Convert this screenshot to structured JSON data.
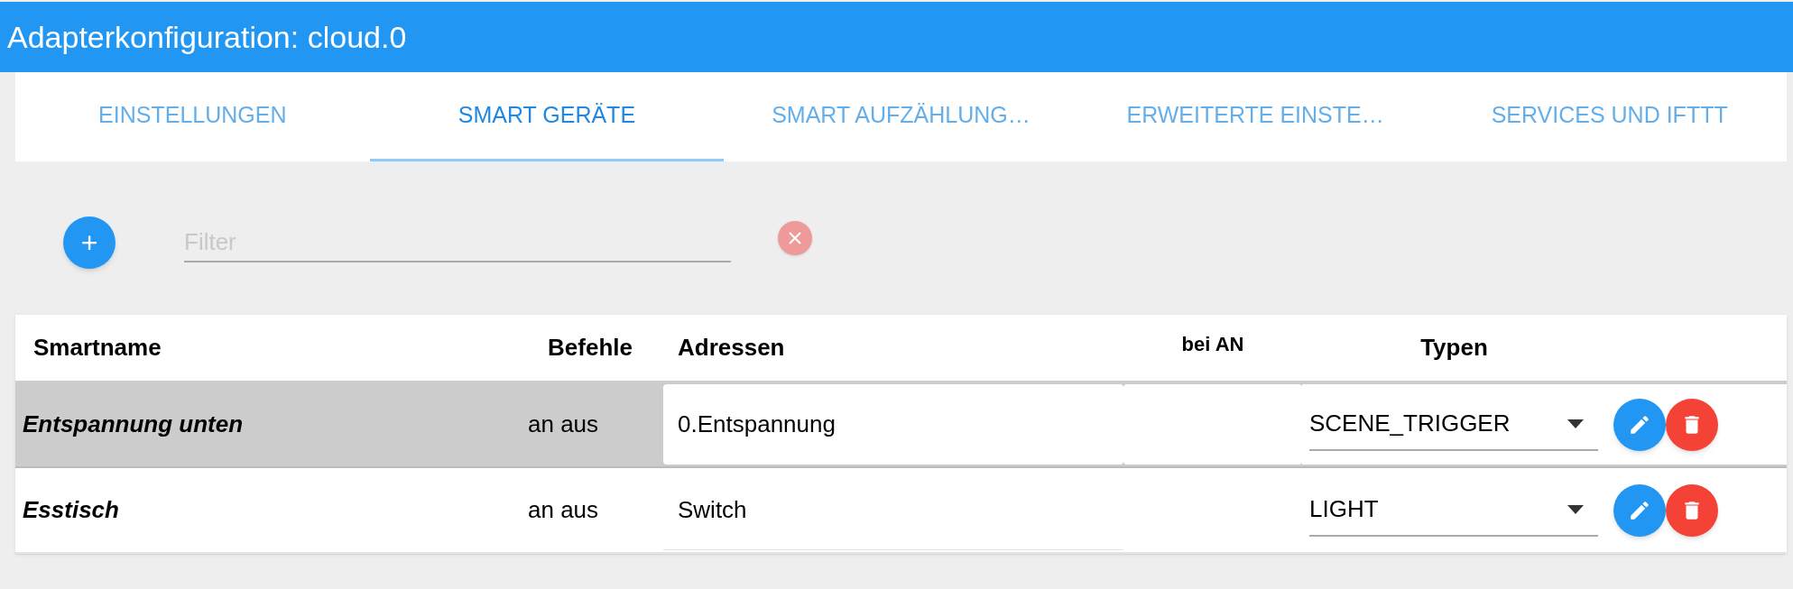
{
  "window": {
    "title": "Adapterkonfiguration: cloud.0"
  },
  "tabs": [
    {
      "label": "EINSTELLUNGEN",
      "selected": false
    },
    {
      "label": "SMART GERÄTE",
      "selected": true
    },
    {
      "label": "SMART AUFZÄHLUNG…",
      "selected": false
    },
    {
      "label": "ERWEITERTE EINSTE…",
      "selected": false
    },
    {
      "label": "SERVICES UND IFTTT",
      "selected": false
    }
  ],
  "filter": {
    "add_button": "+",
    "placeholder": "Filter"
  },
  "table": {
    "columns": [
      "Smartname",
      "Befehle",
      "Adressen",
      "bei AN",
      "Typen"
    ],
    "rows": [
      {
        "smartname": "Entspannung unten",
        "commands": "an aus",
        "address": "0.Entspannung",
        "type": "SCENE_TRIGGER",
        "selected": true
      },
      {
        "smartname": "Esstisch",
        "commands": "an aus",
        "address": "Switch",
        "type": "LIGHT",
        "selected": false
      }
    ]
  }
}
